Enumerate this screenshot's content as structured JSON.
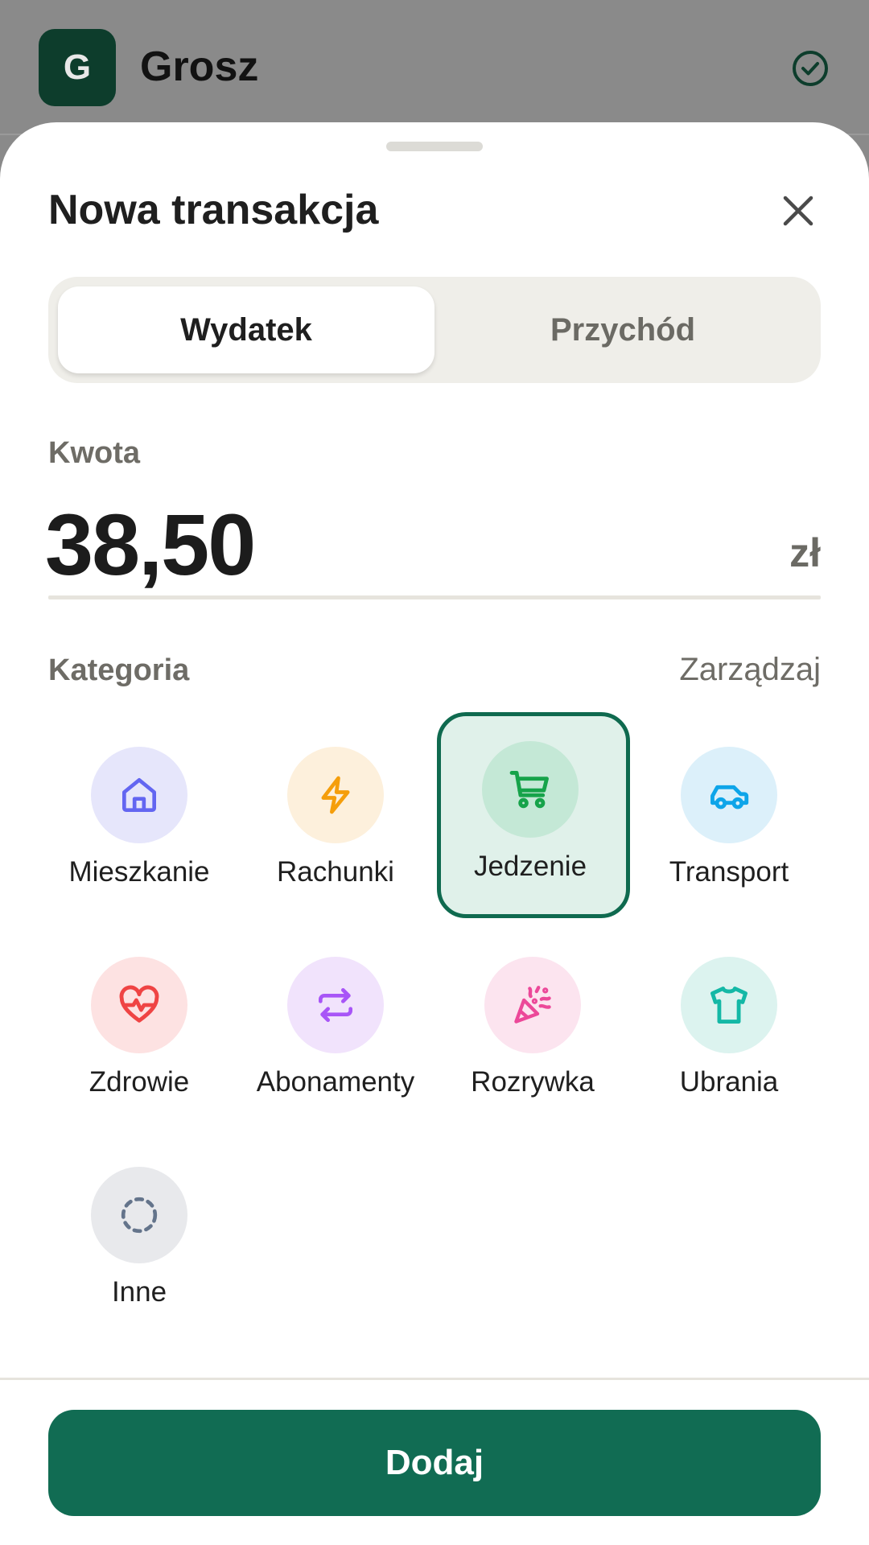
{
  "app": {
    "logo_letter": "G",
    "title": "Grosz",
    "status_icon": "check-circle-icon"
  },
  "sheet": {
    "title": "Nowa transakcja",
    "close_icon": "close-icon",
    "type_tabs": [
      {
        "label": "Wydatek",
        "selected": true
      },
      {
        "label": "Przychód",
        "selected": false
      }
    ],
    "amount": {
      "label": "Kwota",
      "value": "38,50",
      "currency": "zł"
    },
    "category": {
      "label": "Kategoria",
      "manage_label": "Zarządzaj",
      "items": [
        {
          "label": "Mieszkanie",
          "icon": "home-icon",
          "color": "#6366f1",
          "bg": "#e6e6fb",
          "selected": false
        },
        {
          "label": "Rachunki",
          "icon": "bolt-icon",
          "color": "#f59e0b",
          "bg": "#fdf0dc",
          "selected": false
        },
        {
          "label": "Jedzenie",
          "icon": "cart-icon",
          "color": "#16a34a",
          "bg": "#c4e8d6",
          "selected": true
        },
        {
          "label": "Transport",
          "icon": "car-icon",
          "color": "#0ea5e9",
          "bg": "#dcf0fa",
          "selected": false
        },
        {
          "label": "Zdrowie",
          "icon": "heart-pulse-icon",
          "color": "#ef4444",
          "bg": "#fde2e2",
          "selected": false
        },
        {
          "label": "Abonamenty",
          "icon": "repeat-icon",
          "color": "#a855f7",
          "bg": "#f1e3fc",
          "selected": false
        },
        {
          "label": "Rozrywka",
          "icon": "party-icon",
          "color": "#ec4899",
          "bg": "#fce4ef",
          "selected": false
        },
        {
          "label": "Ubrania",
          "icon": "shirt-icon",
          "color": "#14b8a6",
          "bg": "#dcf3ef",
          "selected": false
        },
        {
          "label": "Inne",
          "icon": "dashed-circle-icon",
          "color": "#64748b",
          "bg": "#e8e9ec",
          "selected": false
        }
      ]
    },
    "submit_label": "Dodaj"
  },
  "colors": {
    "primary": "#116c53",
    "logo_bg": "#0d3d2c",
    "selected_bg": "#e0f1ea"
  }
}
